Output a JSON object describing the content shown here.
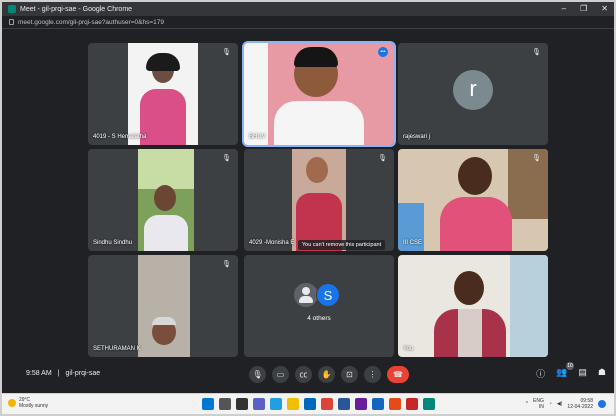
{
  "browser": {
    "title": "Meet - gil-prqi-sae - Google Chrome",
    "url": "meet.google.com/gil-prqi-sae?authuser=0&hs=179"
  },
  "tiles": [
    {
      "name": "4019 - S Hemalatha"
    },
    {
      "name": "BHUV"
    },
    {
      "name": "rajeswari j",
      "initial": "r"
    },
    {
      "name": "Sindhu Sindhu"
    },
    {
      "name": "4029 -Monisha E"
    },
    {
      "name": "III CSE"
    },
    {
      "name": "SETHURAMAN K"
    },
    {
      "name": "4 others",
      "avatar_letter": "S"
    },
    {
      "name": "You"
    }
  ],
  "toast": "You can't remove this participant",
  "meeting": {
    "time": "9:58 AM",
    "code": "gil-prqi-sae"
  },
  "participants_count": "10",
  "taskbar": {
    "weather_temp": "29°C",
    "weather_desc": "Mostly sunny",
    "lang": "ENG",
    "region": "IN",
    "time": "09:58",
    "date": "12-04-2022"
  }
}
